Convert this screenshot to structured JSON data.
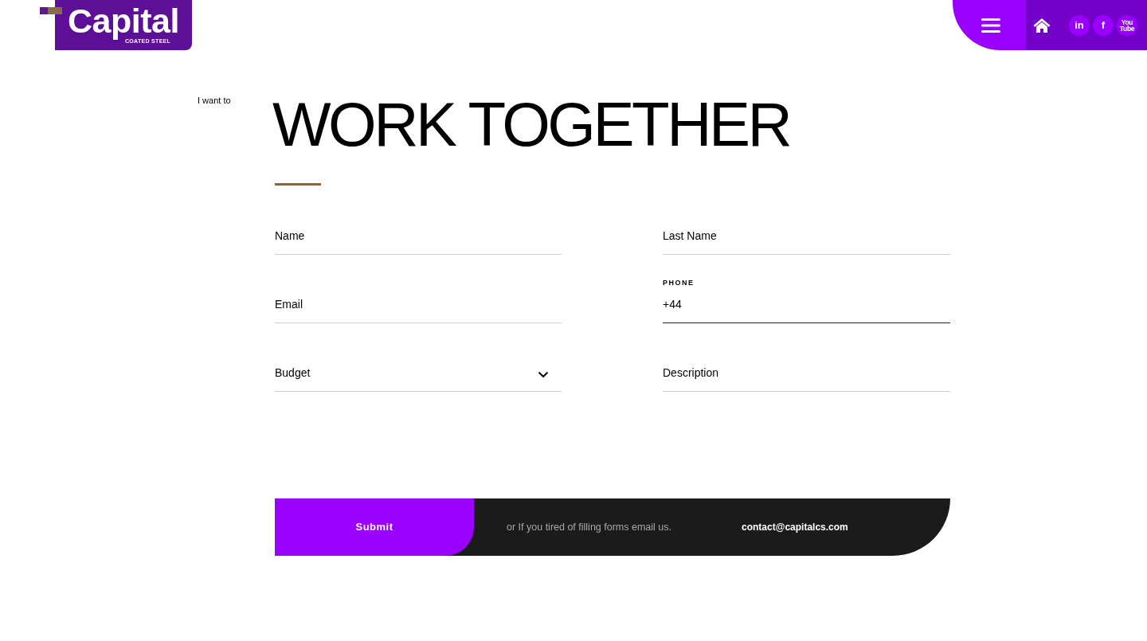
{
  "logo": {
    "name": "Capital",
    "tagline": "COATED STEEL"
  },
  "header": {
    "social_links": [
      {
        "text": "in"
      },
      {
        "text": "f"
      },
      {
        "text": "You Tube"
      }
    ]
  },
  "intro": "I want to",
  "title": "WORK TOGETHER",
  "form": {
    "rows": [
      {
        "fields": [
          {
            "kind": "text",
            "placeholder": "Name",
            "focused": false
          },
          {
            "kind": "text",
            "placeholder": "Last Name",
            "focused": false
          }
        ]
      },
      {
        "fields": [
          {
            "kind": "text",
            "placeholder": "Email",
            "focused": false
          },
          {
            "kind": "phone",
            "label": "PHONE",
            "value": "+44",
            "focused": true
          }
        ]
      },
      {
        "fields": [
          {
            "kind": "select",
            "placeholder": "Budget",
            "focused": false
          },
          {
            "kind": "text",
            "placeholder": "Description",
            "focused": false
          }
        ]
      }
    ]
  },
  "footer_bar": {
    "submit": "Submit",
    "note": "or If you tired of filling forms email us.",
    "email": "contact@capitalcs.com"
  }
}
